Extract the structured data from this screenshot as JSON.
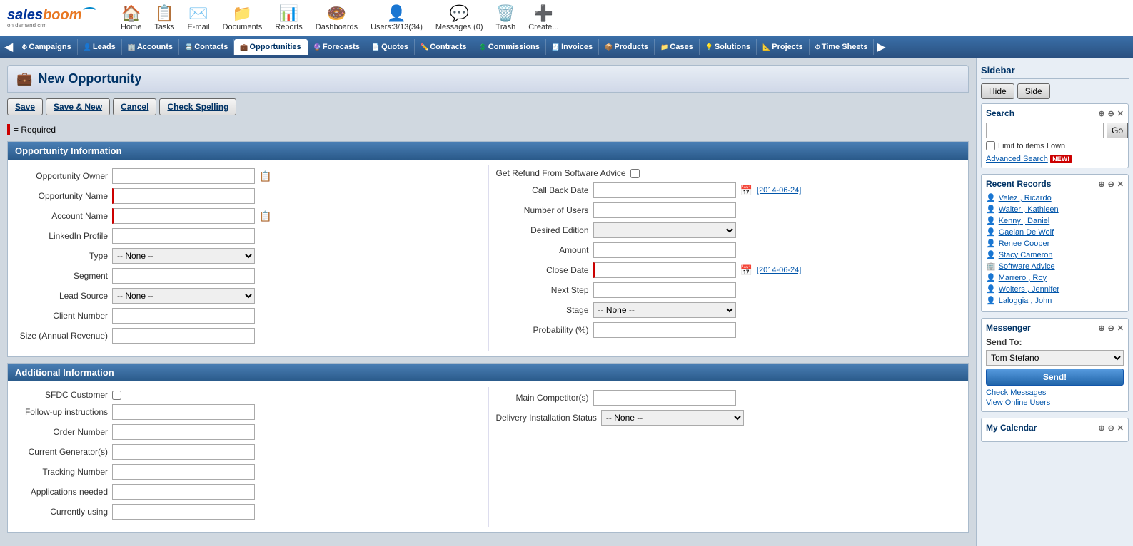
{
  "logo": {
    "sales": "sales",
    "boom": "boom",
    "tagline": "on demand crm"
  },
  "top_nav": {
    "items": [
      {
        "id": "home",
        "label": "Home",
        "icon": "🏠"
      },
      {
        "id": "tasks",
        "label": "Tasks",
        "icon": "📋"
      },
      {
        "id": "email",
        "label": "E-mail",
        "icon": "✉️"
      },
      {
        "id": "documents",
        "label": "Documents",
        "icon": "📁"
      },
      {
        "id": "reports",
        "label": "Reports",
        "icon": "📊"
      },
      {
        "id": "dashboards",
        "label": "Dashboards",
        "icon": "🍩"
      },
      {
        "id": "users",
        "label": "Users:3/13(34)",
        "icon": "👤"
      },
      {
        "id": "messages",
        "label": "Messages (0)",
        "icon": "💬"
      },
      {
        "id": "trash",
        "label": "Trash",
        "icon": "🗑️"
      },
      {
        "id": "create",
        "label": "Create...",
        "icon": "➕"
      }
    ]
  },
  "module_nav": {
    "items": [
      {
        "id": "campaigns",
        "label": "Campaigns"
      },
      {
        "id": "leads",
        "label": "Leads"
      },
      {
        "id": "accounts",
        "label": "Accounts"
      },
      {
        "id": "contacts",
        "label": "Contacts"
      },
      {
        "id": "opportunities",
        "label": "Opportunities",
        "active": true
      },
      {
        "id": "forecasts",
        "label": "Forecasts"
      },
      {
        "id": "quotes",
        "label": "Quotes"
      },
      {
        "id": "contracts",
        "label": "Contracts"
      },
      {
        "id": "commissions",
        "label": "Commissions"
      },
      {
        "id": "invoices",
        "label": "Invoices"
      },
      {
        "id": "products",
        "label": "Products"
      },
      {
        "id": "cases",
        "label": "Cases"
      },
      {
        "id": "solutions",
        "label": "Solutions"
      },
      {
        "id": "projects",
        "label": "Projects"
      },
      {
        "id": "timesheets",
        "label": "Time Sheets"
      }
    ]
  },
  "page": {
    "title": "New Opportunity",
    "required_legend": "= Required"
  },
  "action_buttons": {
    "save": "Save",
    "save_new": "Save & New",
    "cancel": "Cancel",
    "check_spelling": "Check Spelling"
  },
  "form": {
    "opportunity_info_header": "Opportunity Information",
    "additional_info_header": "Additional Information",
    "left_fields": [
      {
        "id": "opportunity_owner",
        "label": "Opportunity Owner",
        "type": "text",
        "required": false,
        "has_lookup": true
      },
      {
        "id": "opportunity_name",
        "label": "Opportunity Name",
        "type": "text",
        "required": true
      },
      {
        "id": "account_name",
        "label": "Account Name",
        "type": "text",
        "required": true,
        "has_lookup": true
      },
      {
        "id": "linkedin_profile",
        "label": "LinkedIn Profile",
        "type": "text"
      },
      {
        "id": "type",
        "label": "Type",
        "type": "select",
        "value": "-- None --",
        "options": [
          "-- None --"
        ]
      },
      {
        "id": "segment",
        "label": "Segment",
        "type": "text"
      },
      {
        "id": "lead_source",
        "label": "Lead Source",
        "type": "select",
        "value": "-- None --",
        "options": [
          "-- None --"
        ]
      },
      {
        "id": "client_number",
        "label": "Client Number",
        "type": "text"
      },
      {
        "id": "size",
        "label": "Size (Annual Revenue)",
        "type": "text"
      }
    ],
    "right_fields": [
      {
        "id": "get_refund",
        "label": "Get Refund From Software Advice",
        "type": "checkbox"
      },
      {
        "id": "call_back_date",
        "label": "Call Back Date",
        "type": "date",
        "date_value": "[2014-06-24]"
      },
      {
        "id": "num_users",
        "label": "Number of Users",
        "type": "text"
      },
      {
        "id": "desired_edition",
        "label": "Desired Edition",
        "type": "select",
        "value": "",
        "options": [
          ""
        ]
      },
      {
        "id": "amount",
        "label": "Amount",
        "type": "text"
      },
      {
        "id": "close_date",
        "label": "Close Date",
        "type": "date",
        "date_value": "[2014-06-24]",
        "required": true
      },
      {
        "id": "next_step",
        "label": "Next Step",
        "type": "text"
      },
      {
        "id": "stage",
        "label": "Stage",
        "type": "select",
        "value": "-- None --",
        "options": [
          "-- None --"
        ]
      },
      {
        "id": "probability",
        "label": "Probability (%)",
        "type": "text"
      }
    ],
    "additional_left": [
      {
        "id": "sfdc_customer",
        "label": "SFDC Customer",
        "type": "checkbox"
      },
      {
        "id": "followup",
        "label": "Follow-up instructions",
        "type": "text"
      },
      {
        "id": "order_number",
        "label": "Order Number",
        "type": "text"
      },
      {
        "id": "current_generator",
        "label": "Current Generator(s)",
        "type": "text"
      },
      {
        "id": "tracking_number",
        "label": "Tracking Number",
        "type": "text"
      },
      {
        "id": "applications_needed",
        "label": "Applications needed",
        "type": "text"
      },
      {
        "id": "currently_using",
        "label": "Currently using",
        "type": "text"
      }
    ],
    "additional_right": [
      {
        "id": "main_competitors",
        "label": "Main Competitor(s)",
        "type": "text"
      },
      {
        "id": "delivery_status",
        "label": "Delivery Installation Status",
        "type": "select",
        "value": "-- None --",
        "options": [
          "-- None --"
        ]
      }
    ]
  },
  "sidebar": {
    "title": "Sidebar",
    "hide_label": "Hide",
    "side_label": "Side",
    "search": {
      "title": "Search",
      "placeholder": "",
      "go_label": "Go",
      "limit_label": "Limit to items I own",
      "advanced_label": "Advanced Search",
      "new_badge": "NEW!"
    },
    "recent_records": {
      "title": "Recent Records",
      "items": [
        {
          "name": "Velez , Ricardo"
        },
        {
          "name": "Walter , Kathleen"
        },
        {
          "name": "Kenny , Daniel"
        },
        {
          "name": "Gaelan De Wolf "
        },
        {
          "name": "Renee Cooper "
        },
        {
          "name": "Stacy Cameron "
        },
        {
          "name": "Software Advice"
        },
        {
          "name": "Marrero , Roy"
        },
        {
          "name": "Wolters , Jennifer"
        },
        {
          "name": "Laloggia , John"
        }
      ]
    },
    "messenger": {
      "title": "Messenger",
      "send_to_label": "Send To:",
      "send_to_value": "Tom Stefano",
      "send_btn": "Send!",
      "check_messages": "Check Messages",
      "view_online": "View Online Users"
    },
    "calendar": {
      "title": "My Calendar"
    }
  }
}
